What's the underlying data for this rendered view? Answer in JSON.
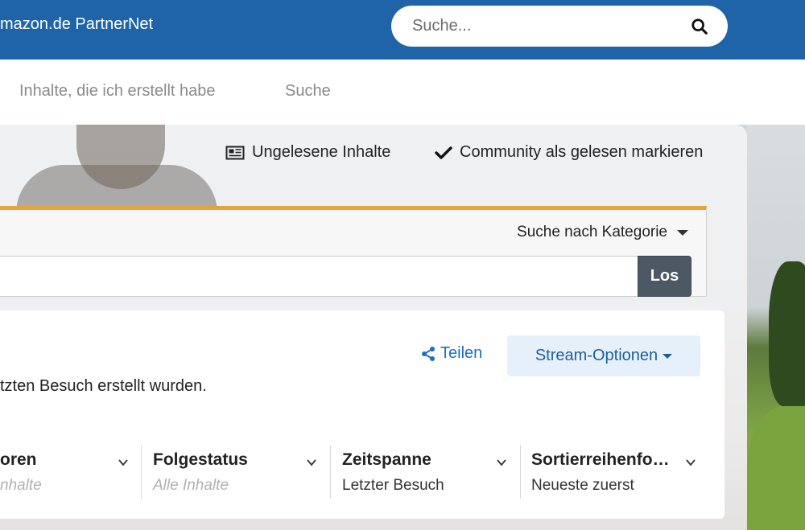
{
  "header": {
    "site_title": "mazon.de PartnerNet",
    "search_placeholder": "Suche..."
  },
  "nav": {
    "items": [
      {
        "label": "Inhalte, die ich erstellt habe"
      },
      {
        "label": "Suche"
      }
    ]
  },
  "quick_links": {
    "unread": "Ungelesene Inhalte",
    "mark_read": "Community als gelesen markieren"
  },
  "search_form": {
    "category_select": "Suche nach Kategorie",
    "go_button": "Los"
  },
  "stream": {
    "share_label": "Teilen",
    "options_label": "Stream-Optionen",
    "description": "tzten Besuch erstellt wurden.",
    "filters": [
      {
        "title": "oren",
        "value": "nhalte",
        "muted": true
      },
      {
        "title": "Folgestatus",
        "value": "Alle Inhalte",
        "muted": true
      },
      {
        "title": "Zeitspanne",
        "value": "Letzter Besuch",
        "muted": false
      },
      {
        "title": "Sortierreihenfo…",
        "value": "Neueste zuerst",
        "muted": false
      }
    ]
  },
  "colors": {
    "topbar": "#1f64a8",
    "accent_orange": "#e9a13b",
    "link_blue": "#1f6fbf",
    "button_dark": "#4d5865"
  }
}
